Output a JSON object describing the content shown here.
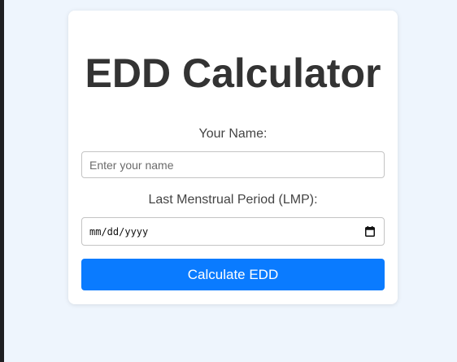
{
  "form": {
    "title": "EDD Calculator",
    "name_label": "Your Name:",
    "name_placeholder": "Enter your name",
    "lmp_label": "Last Menstrual Period (LMP):",
    "lmp_value_display": "mm/dd/yyyy",
    "calculate_button": "Calculate EDD"
  },
  "colors": {
    "background": "#eef5fd",
    "card": "#ffffff",
    "button": "#0a7bff",
    "title": "#333333"
  },
  "icons": {
    "date_picker": "calendar-icon"
  }
}
